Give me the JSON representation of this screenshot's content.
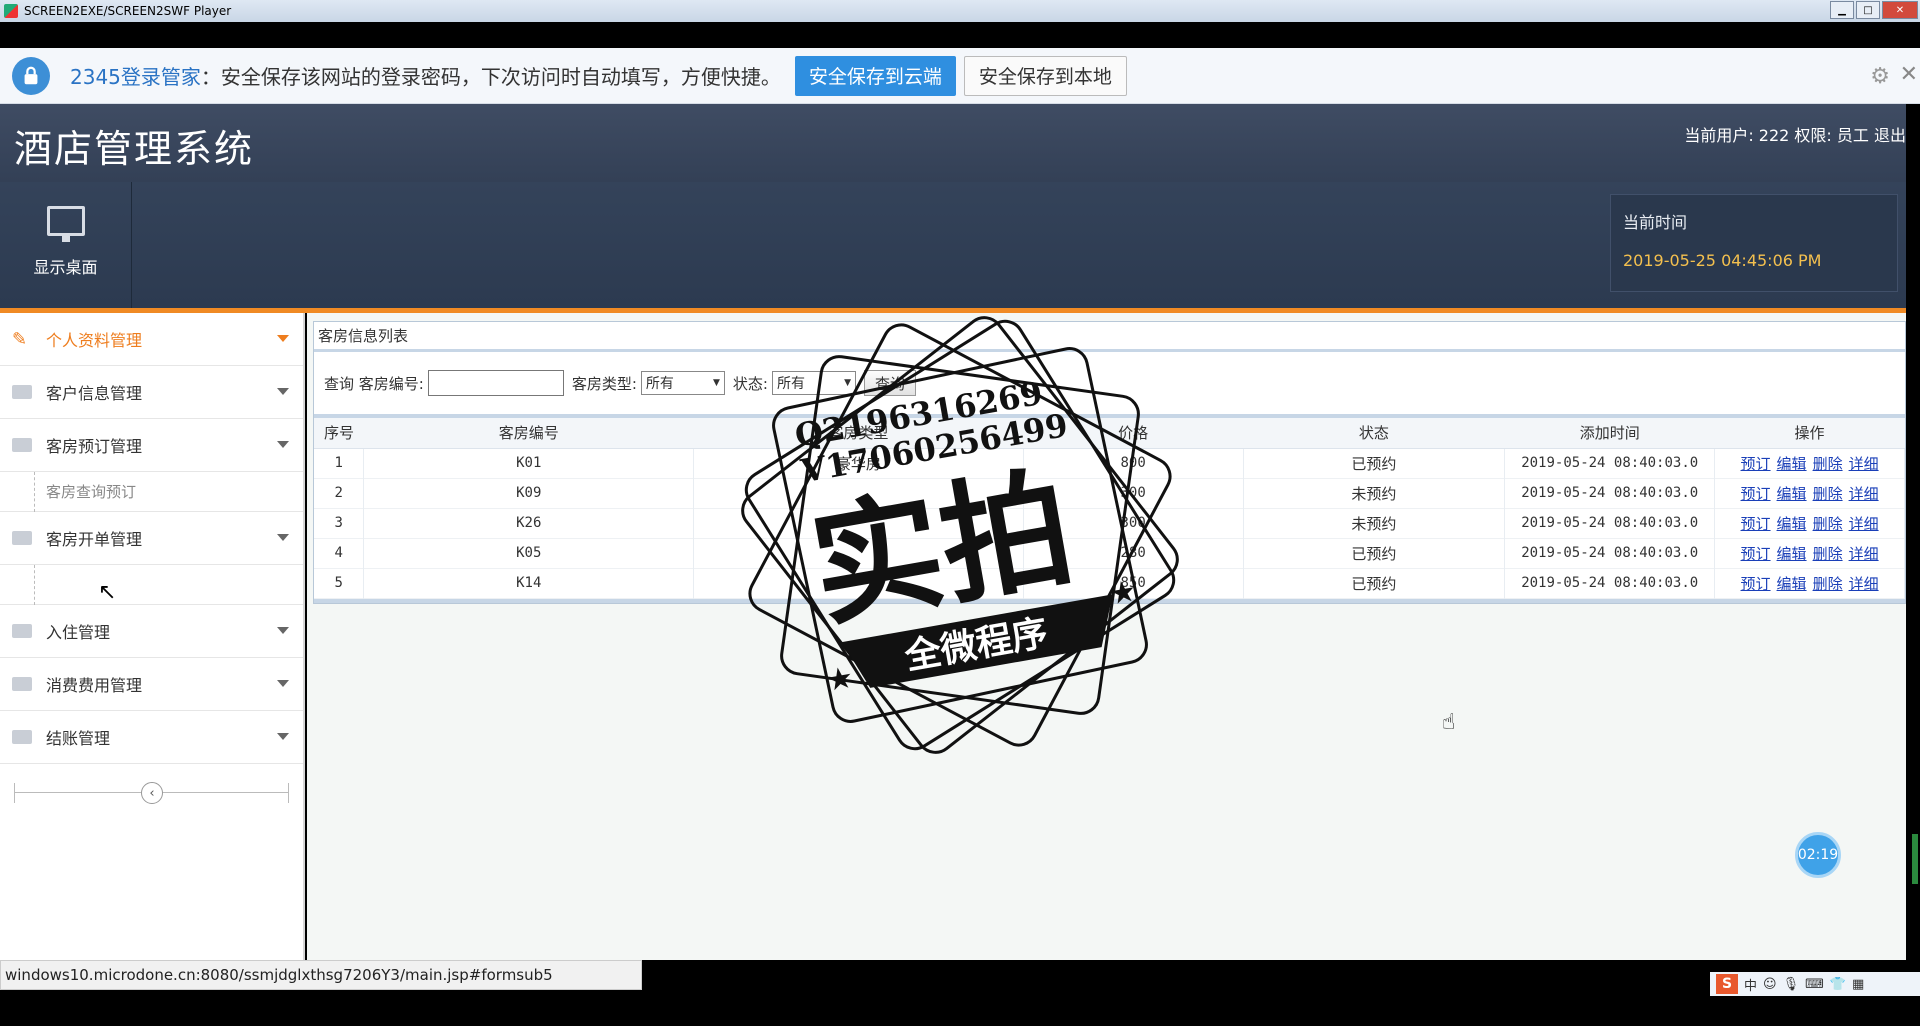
{
  "player": {
    "title": "SCREEN2EXE/SCREEN2SWF Player"
  },
  "password_bar": {
    "brand": "2345登录管家",
    "message": "：安全保存该网站的登录密码，下次访问时自动填写，方便快捷。",
    "save_cloud_label": "安全保存到云端",
    "save_local_label": "安全保存到本地",
    "settings_icon": "gear-icon",
    "close_icon": "close-icon"
  },
  "header": {
    "title": "酒店管理系统",
    "user_info": "当前用户: 222  权限: 员工  退出"
  },
  "toolbar": {
    "desktop_label": "显示桌面",
    "time_label": "当前时间",
    "time_value": "2019-05-25 04:45:06 PM"
  },
  "sidebar": {
    "items": [
      {
        "label": "个人资料管理",
        "icon": "pencil-icon",
        "active": true
      },
      {
        "label": "客户信息管理",
        "icon": "id-card-icon"
      },
      {
        "label": "客房预订管理",
        "icon": "grid-icon"
      },
      {
        "label": "客房开单管理",
        "icon": "layout-icon"
      },
      {
        "label": "入住管理",
        "icon": "calendar-icon"
      },
      {
        "label": "消费费用管理",
        "icon": "brush-icon"
      },
      {
        "label": "结账管理",
        "icon": "brush-icon"
      }
    ],
    "sub_item": "客房查询预订",
    "collapse_icon": "chevron-left-icon"
  },
  "panel": {
    "title": "客房信息列表",
    "search": {
      "query_label": "查询",
      "room_no_label": "客房编号:",
      "room_no_value": "",
      "room_type_label": "客房类型:",
      "room_type_value": "所有",
      "status_label": "状态:",
      "status_value": "所有",
      "search_button": "查询"
    },
    "columns": [
      "序号",
      "客房编号",
      "客房类型",
      "价格",
      "状态",
      "添加时间",
      "操作"
    ],
    "rows": [
      {
        "no": "1",
        "room": "K01",
        "type": "豪华房",
        "price": "800",
        "status": "已预约",
        "time": "2019-05-24 08:40:03.0"
      },
      {
        "no": "2",
        "room": "K09",
        "type": "",
        "price": "300",
        "status": "未预约",
        "time": "2019-05-24 08:40:03.0"
      },
      {
        "no": "3",
        "room": "K26",
        "type": "",
        "price": "300",
        "status": "未预约",
        "time": "2019-05-24 08:40:03.0"
      },
      {
        "no": "4",
        "room": "K05",
        "type": "",
        "price": "280",
        "status": "已预约",
        "time": "2019-05-24 08:40:03.0"
      },
      {
        "no": "5",
        "room": "K14",
        "type": "",
        "price": "850",
        "status": "已预约",
        "time": "2019-05-24 08:40:03.0"
      }
    ],
    "actions": [
      "预订",
      "编辑",
      "删除",
      "详细"
    ]
  },
  "status_url": "windows10.microdone.cn:8080/ssmjdglxthsg7206Y3/main.jsp#formsub5",
  "timer": "02:19",
  "watermark": {
    "line1": "Q2196316269",
    "line2": "V17060256499",
    "big": "实拍",
    "ribbon": "全微程序"
  },
  "ime": {
    "logo": "S",
    "text": "中"
  }
}
